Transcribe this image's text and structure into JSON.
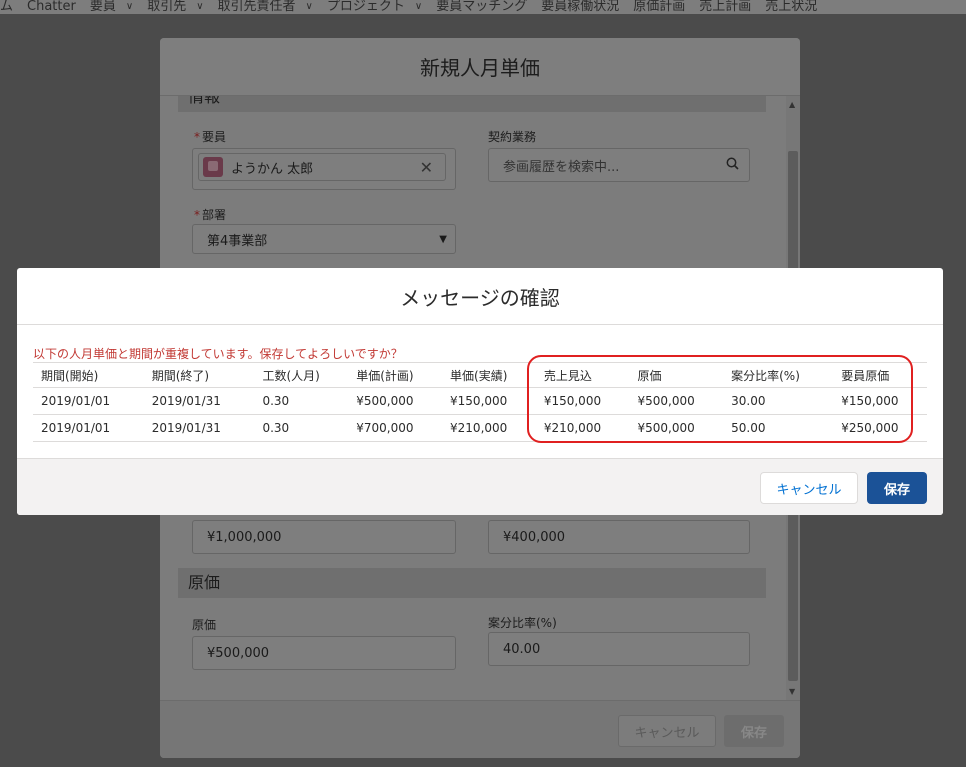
{
  "topnav": {
    "items": [
      {
        "label": "ム",
        "chevron": false
      },
      {
        "label": "Chatter",
        "chevron": false
      },
      {
        "label": "要員",
        "chevron": true
      },
      {
        "label": "取引先",
        "chevron": true
      },
      {
        "label": "取引先責任者",
        "chevron": true
      },
      {
        "label": "プロジェクト",
        "chevron": true
      },
      {
        "label": "要員マッチング",
        "chevron": false
      },
      {
        "label": "要員稼働状況",
        "chevron": false
      },
      {
        "label": "原価計画",
        "chevron": false
      },
      {
        "label": "売上計画",
        "chevron": false
      },
      {
        "label": "売上状況",
        "chevron": false
      }
    ]
  },
  "base_modal": {
    "title": "新規人月単価",
    "section_partial": "情報",
    "staff_label": "要員",
    "staff_value": "ようかん 太郎",
    "contract_label": "契約業務",
    "contract_placeholder": "参画履歴を検索中...",
    "dept_label": "部署",
    "dept_value": "第4事業部",
    "amount_left": "¥1,000,000",
    "amount_right": "¥400,000",
    "cost_section": "原価",
    "cost_label": "原価",
    "cost_value": "¥500,000",
    "ratio_label": "案分比率(%)",
    "ratio_value": "40.00",
    "cancel_label": "キャンセル",
    "save_label": "保存"
  },
  "dialog": {
    "title": "メッセージの確認",
    "message": "以下の人月単価と期間が重複しています。保存してよろしいですか？",
    "columns": [
      "期間(開始)",
      "期間(終了)",
      "工数(人月)",
      "単価(計画)",
      "単価(実績)",
      "売上見込",
      "原価",
      "案分比率(%)",
      "要員原価"
    ],
    "rows": [
      [
        "2019/01/01",
        "2019/01/31",
        "0.30",
        "¥500,000",
        "¥150,000",
        "¥150,000",
        "¥500,000",
        "30.00",
        "¥150,000"
      ],
      [
        "2019/01/01",
        "2019/01/31",
        "0.30",
        "¥700,000",
        "¥210,000",
        "¥210,000",
        "¥500,000",
        "50.00",
        "¥250,000"
      ]
    ],
    "cancel_label": "キャンセル",
    "save_label": "保存"
  },
  "colors": {
    "error_text": "#c23934",
    "highlight": "#e02020",
    "brand_button": "#1b5297"
  }
}
